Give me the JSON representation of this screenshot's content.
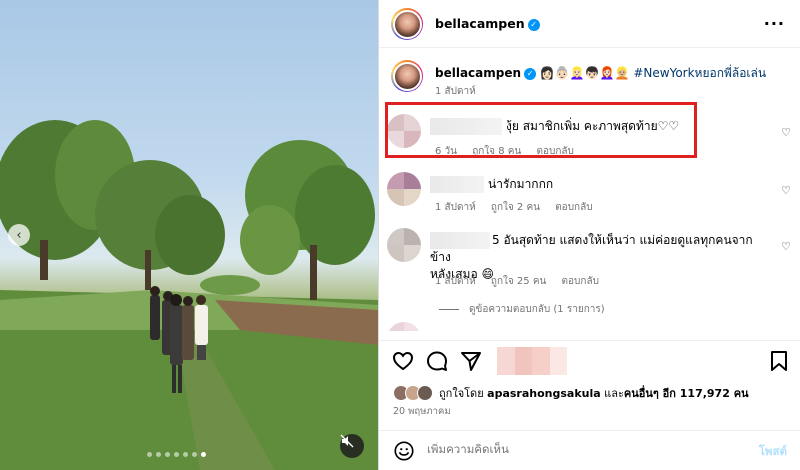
{
  "post": {
    "author": "bellacampen",
    "caption_author": "bellacampen",
    "caption_emojis": "👩🏻👵🏻👱🏻‍♀️👦🏻👩🏻‍🦰👱🏼",
    "caption_hashtag": "#NewYorkหยอกพี่ล้อเล่น",
    "caption_time": "1 สัปดาห์"
  },
  "comments": [
    {
      "text": "งุ้ย สมาชิกเพิ่ม คะภาพสุดท้าย♡♡",
      "time": "6 วัน",
      "likes": "ถูกใจ 8 คน",
      "reply": "ตอบกลับ",
      "avatar_colors": [
        "#d8c0c3",
        "#e6d3d6",
        "#e9d9dc",
        "#d9b7bd"
      ]
    },
    {
      "text": "น่ารักมากกก",
      "time": "1 สัปดาห์",
      "likes": "ถูกใจ 2 คน",
      "reply": "ตอบกลับ",
      "avatar_colors": [
        "#c49bb0",
        "#a87e99",
        "#d6c4b4",
        "#e4d7c8"
      ]
    },
    {
      "text": "5 อันสุดท้าย แสดงให้เห็นว่า แม่ค่อยดูแลทุกคนจากข้าง",
      "text2": "หลังเสมอ 😄",
      "time": "1 สัปดาห์",
      "likes": "ถูกใจ 25 คน",
      "reply": "ตอบกลับ",
      "avatar_colors": [
        "#d0c8c4",
        "#bdb3ae",
        "#cfc5c0",
        "#ddd5d0"
      ]
    }
  ],
  "view_replies": "ดูข้อความตอบกลับ (1 รายการ)",
  "likes_summary": {
    "prefix": "ถูกใจโดย",
    "user": "apasrahongsakula",
    "middle": "และ",
    "others": "คนอื่นๆ อีก 117,972 คน"
  },
  "date": "20 พฤษภาคม",
  "comment_box": {
    "placeholder": "เพิ่มความคิดเห็น",
    "post_label": "โพสต์"
  },
  "colors": {
    "highlight": "#e02020",
    "verified": "#0095f6",
    "hashtag": "#00376b"
  },
  "icons": {
    "like": "heart-icon",
    "comment": "comment-icon",
    "share": "paper-plane-icon",
    "save": "bookmark-icon",
    "more": "more-icon",
    "emoji": "emoji-icon",
    "mute": "mute-icon",
    "prev": "chevron-left-icon"
  },
  "carousel": {
    "slide_count": 7,
    "active_slide": 7
  }
}
